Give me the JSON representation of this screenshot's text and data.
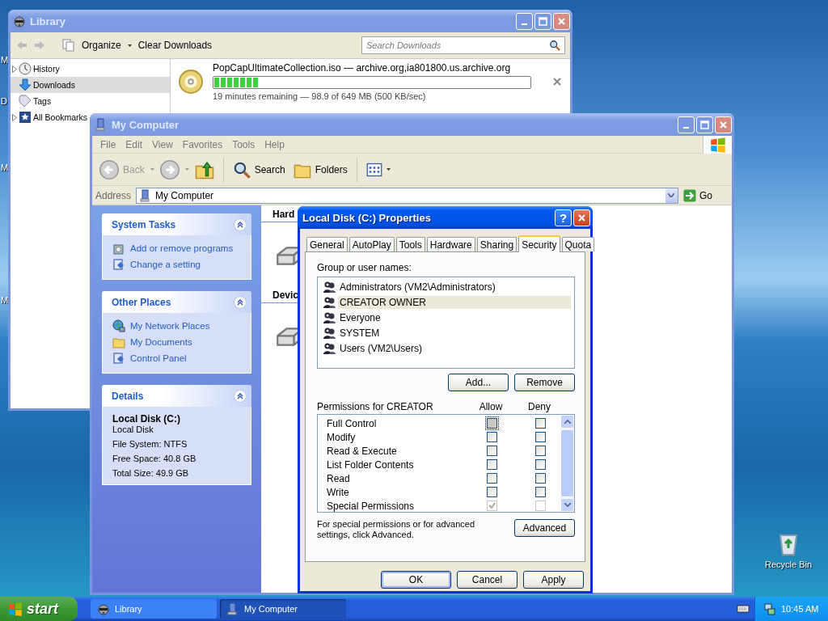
{
  "desktop": {
    "edge_labels": [
      "M",
      "D",
      "M",
      "M"
    ],
    "icons": [
      {
        "label": "Recycle Bin"
      }
    ]
  },
  "library": {
    "title": "Library",
    "organize": "Organize",
    "clear": "Clear Downloads",
    "search_placeholder": "Search Downloads",
    "sidebar": [
      {
        "label": "History",
        "selected": false,
        "expandable": true
      },
      {
        "label": "Downloads",
        "selected": true,
        "expandable": false
      },
      {
        "label": "Tags",
        "selected": false,
        "expandable": false
      },
      {
        "label": "All Bookmarks",
        "selected": false,
        "expandable": true
      }
    ],
    "download": {
      "name": "PopCapUltimateCollection.iso — archive.org,ia801800.us.archive.org",
      "level": 0.14,
      "status": "19 minutes remaining — 98.9 of 649 MB (500 KB/sec)"
    }
  },
  "my_computer": {
    "title": "My Computer",
    "menu": [
      "File",
      "Edit",
      "View",
      "Favorites",
      "Tools",
      "Help"
    ],
    "toolbar": {
      "back": "Back",
      "back_disabled": true,
      "search": "Search",
      "folders": "Folders"
    },
    "address": {
      "label": "Address",
      "value": "My Computer",
      "go": "Go"
    },
    "panels": [
      {
        "kind": "links",
        "title": "System Tasks",
        "items": [
          "Add or remove programs",
          "Change a setting"
        ]
      },
      {
        "kind": "links",
        "title": "Other Places",
        "items": [
          "My Network Places",
          "My Documents",
          "Control Panel"
        ]
      },
      {
        "kind": "details",
        "title": "Details",
        "heading": "Local Disk (C:)",
        "items": [
          "Local Disk",
          "File System: NTFS",
          "Free Space: 40.8 GB",
          "Total Size: 49.9 GB"
        ]
      }
    ],
    "groups": [
      "Hard",
      "Devic"
    ]
  },
  "dialog": {
    "title": "Local Disk (C:) Properties",
    "help": "?",
    "tabs": [
      {
        "label": "General",
        "selected": false
      },
      {
        "label": "AutoPlay",
        "selected": false
      },
      {
        "label": "Tools",
        "selected": false
      },
      {
        "label": "Hardware",
        "selected": false
      },
      {
        "label": "Sharing",
        "selected": false
      },
      {
        "label": "Security",
        "selected": true
      },
      {
        "label": "Quota",
        "selected": false
      }
    ],
    "users_label": "Group or user names:",
    "users": [
      {
        "name": "Administrators (VM2\\Administrators)",
        "selected": false
      },
      {
        "name": "CREATOR OWNER",
        "selected": true
      },
      {
        "name": "Everyone",
        "selected": false
      },
      {
        "name": "SYSTEM",
        "selected": false
      },
      {
        "name": "Users (VM2\\Users)",
        "selected": false
      }
    ],
    "user_buttons": [
      "Add...",
      "Remove"
    ],
    "permissions_label": "Permissions for CREATOR",
    "allow": "Allow",
    "deny": "Deny",
    "permissions": [
      {
        "name": "Full Control",
        "allow": {
          "checked": false,
          "disabled": false
        },
        "deny": {
          "checked": false,
          "disabled": false
        }
      },
      {
        "name": "Modify",
        "allow": {
          "checked": false,
          "disabled": false
        },
        "deny": {
          "checked": false,
          "disabled": false
        }
      },
      {
        "name": "Read & Execute",
        "allow": {
          "checked": false,
          "disabled": false
        },
        "deny": {
          "checked": false,
          "disabled": false
        }
      },
      {
        "name": "List Folder Contents",
        "allow": {
          "checked": false,
          "disabled": false
        },
        "deny": {
          "checked": false,
          "disabled": false
        }
      },
      {
        "name": "Read",
        "allow": {
          "checked": false,
          "disabled": false
        },
        "deny": {
          "checked": false,
          "disabled": false
        }
      },
      {
        "name": "Write",
        "allow": {
          "checked": false,
          "disabled": false
        },
        "deny": {
          "checked": false,
          "disabled": false
        }
      },
      {
        "name": "Special Permissions",
        "allow": {
          "checked": true,
          "disabled": true
        },
        "deny": {
          "checked": false,
          "disabled": true
        }
      }
    ],
    "advanced_note": "For special permissions or for advanced settings, click Advanced.",
    "advanced": "Advanced",
    "buttons": [
      "OK",
      "Cancel",
      "Apply"
    ]
  },
  "taskbar": {
    "start": "start",
    "tasks": [
      {
        "label": "Library",
        "selected": false
      },
      {
        "label": "My Computer",
        "selected": true
      }
    ],
    "clock": "10:45 AM"
  }
}
